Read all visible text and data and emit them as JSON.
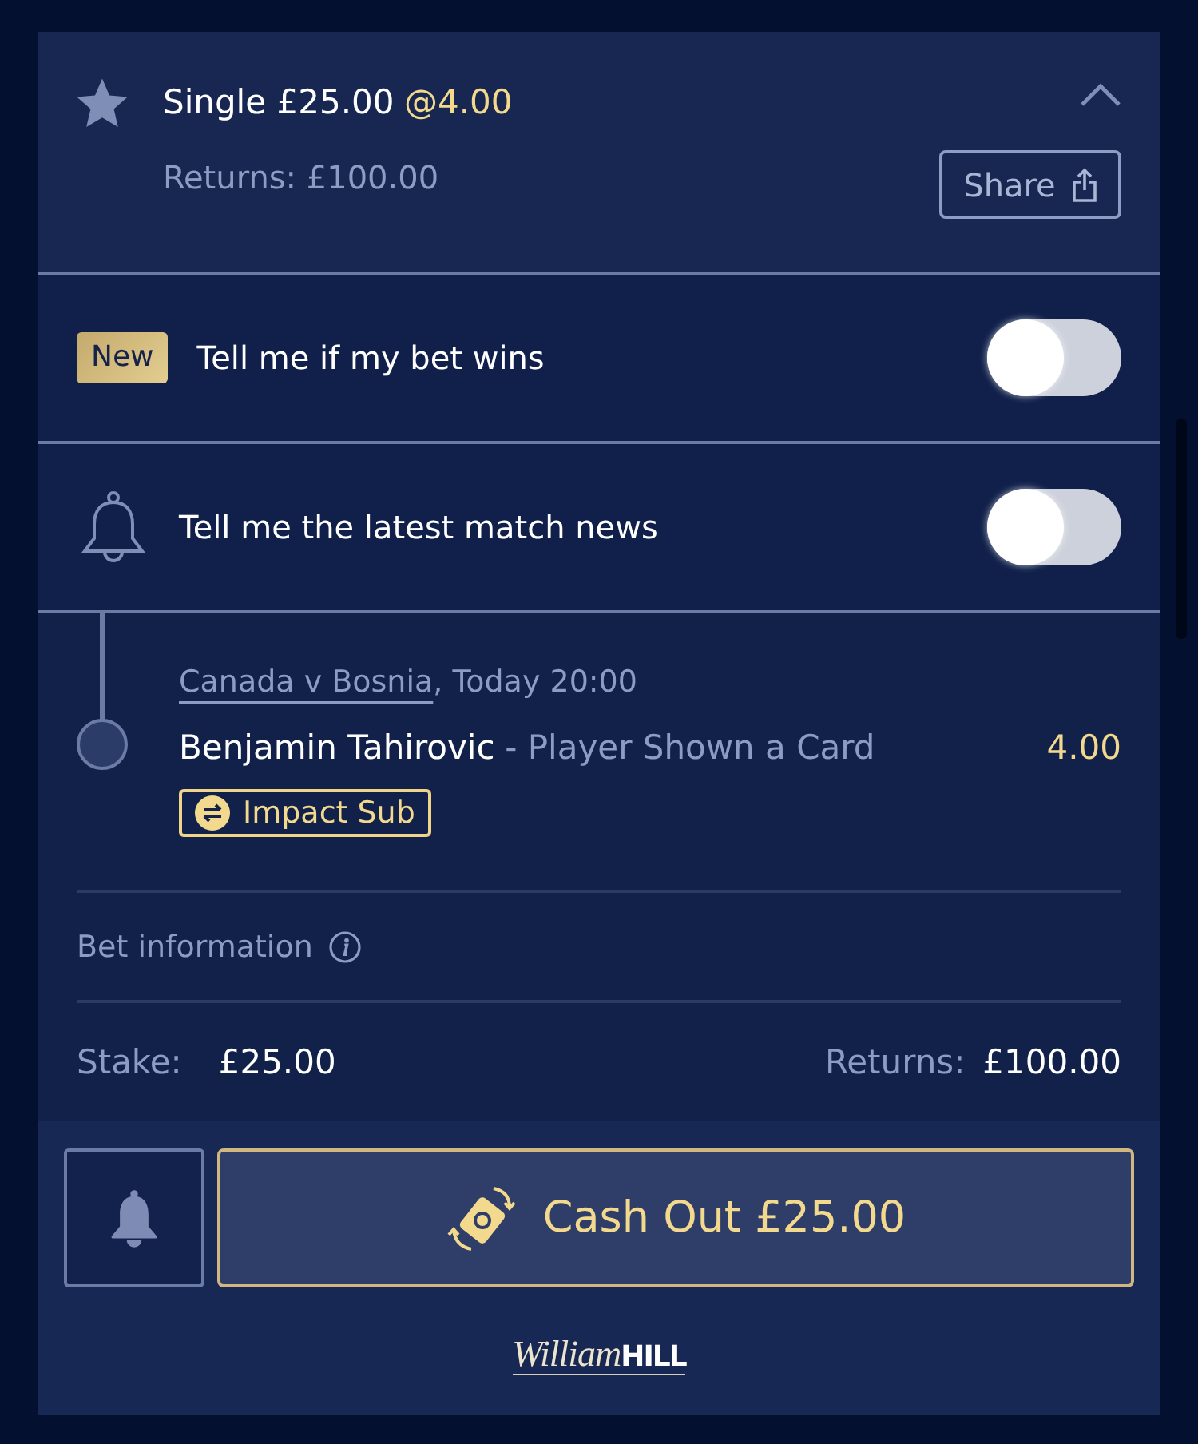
{
  "bet": {
    "title": "Single £25.00",
    "odds": "@4.00",
    "expanded": true,
    "returns": "Returns: £100.00",
    "share_button": "Share"
  },
  "notifications": [
    {
      "kind": "badge",
      "badge": "New",
      "label": "Tell me if my bet wins",
      "on": false
    },
    {
      "kind": "bell",
      "label": "Tell me the latest match news",
      "on": false
    }
  ],
  "selection": {
    "event": "Canada v Bosnia",
    "time": ", Today 20:00",
    "player": "Benjamin Tahirovic",
    "market": "- Player Shown a Card",
    "odds": "4.00",
    "tag": "Impact Sub"
  },
  "bet_information": "Bet information",
  "summary": {
    "stake_label": "Stake:",
    "stake": "£25.00",
    "returns_label": "Returns:",
    "returns": "£100.00"
  },
  "actions": {
    "cash_out_button": "Cash Out £25.00"
  },
  "logo": {
    "script": "William",
    "wordmark": "HILL"
  }
}
